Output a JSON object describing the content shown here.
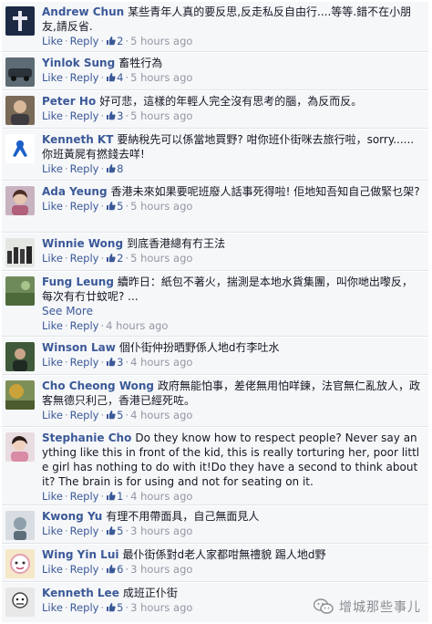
{
  "ui": {
    "like": "Like",
    "reply": "Reply",
    "see_more": "See More"
  },
  "icons": {
    "like_count": "thumbs-up-icon"
  },
  "colors": {
    "link": "#3b5998",
    "meta": "#9197a3",
    "row_bg": "#f6f7f9"
  },
  "comments": [
    {
      "name": "Andrew Chun",
      "text": "某些青年人真的要反思,反走私反自由行....等等.錯不在小朋友,請反省.",
      "likes": "2",
      "time": "5 hours ago"
    },
    {
      "name": "Yinlok Sung",
      "text": "畜牲行為",
      "likes": "4",
      "time": "5 hours ago"
    },
    {
      "name": "Peter Ho",
      "text": "好可悲，這樣的年輕人完全沒有思考的腦，為反而反。",
      "likes": "3",
      "time": "5 hours ago"
    },
    {
      "name": "Kenneth KT",
      "text": "要納稅先可以係當地買野? 咁你班仆街咪去旅行啦，sorry......你班黃屍有撚錢去咩!",
      "likes": "8",
      "time": "5 hours ago"
    },
    {
      "name": "Ada Yeung",
      "text": "香港未來如果要呢班廢人話事死得啦! 佢地知吾知自己做緊乜架?",
      "likes": "5",
      "time": "5 hours ago"
    },
    {
      "name": "Winnie Wong",
      "text": "到底香港總有冇王法",
      "likes": "2",
      "time": "5 hours ago"
    },
    {
      "name": "Fung Leung",
      "text": "續昨日：紙包不著火，揣測是本地水貨集團，叫你哋出嚟反，每次有冇廿蚊呢? ...",
      "likes": "",
      "time": "4 hours ago"
    },
    {
      "name": "Winson Law",
      "text": "個仆街仲扮晒野係人地d冇李吐水",
      "likes": "3",
      "time": "4 hours ago"
    },
    {
      "name": "Cho Cheong Wong",
      "text": "政府無能怕事，差佬無用怕咩鍊，法官無仁亂放人，政客無德只利己，香港已經死咗。",
      "likes": "5",
      "time": "4 hours ago"
    },
    {
      "name": "Stephanie Cho",
      "text": "Do they know how to respect people? Never say anything like this in front of the kid, this is really torturing her, poor little girl has nothing to do with it!Do they have a second to think about it? The brain is for using and not for seating on it.",
      "likes": "1",
      "time": "4 hours ago"
    },
    {
      "name": "Kwong Yu",
      "text": "有理不用帶面具，自己無面見人",
      "likes": "5",
      "time": "3 hours ago"
    },
    {
      "name": "Wing Yin Lui",
      "text": "最仆街係對d老人家都咁無禮貌 踢人地d野",
      "likes": "6",
      "time": "3 hours ago"
    },
    {
      "name": "Kenneth Lee",
      "text": "成班正仆街",
      "likes": "5",
      "time": "3 hours ago"
    }
  ],
  "watermark": "增城那些事儿"
}
